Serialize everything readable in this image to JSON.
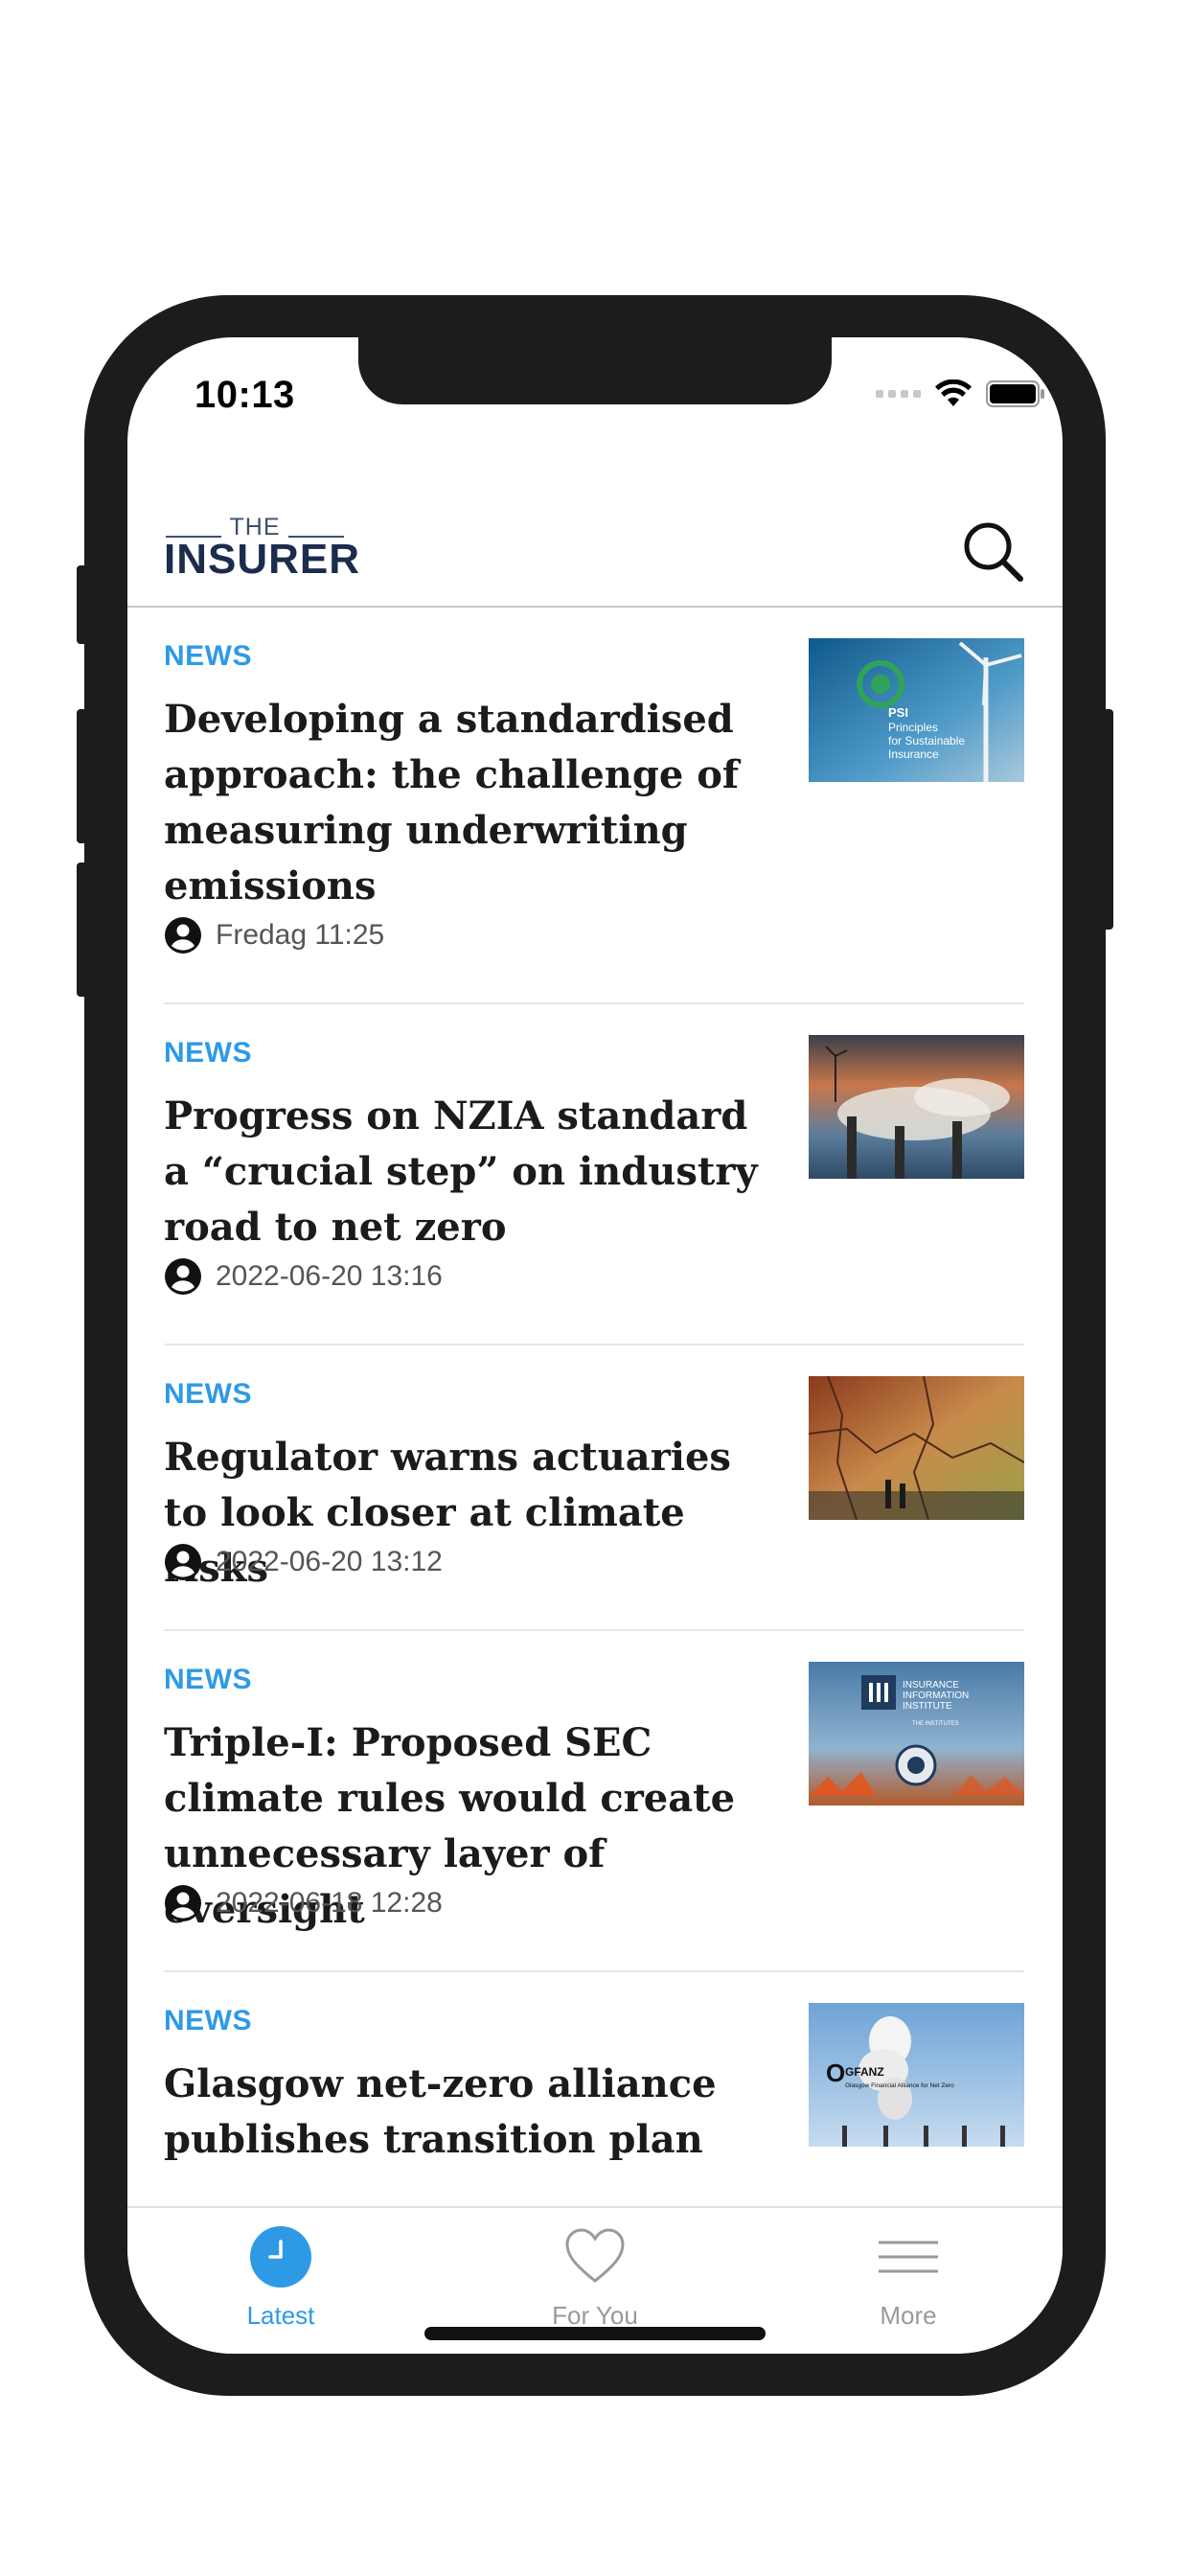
{
  "status_bar": {
    "time": "10:13"
  },
  "header": {
    "logo_top": "THE",
    "logo_main": "INSURER",
    "search_icon": "search-icon"
  },
  "articles": [
    {
      "category": "NEWS",
      "title": "Developing a standardised approach: the challenge of measuring underwriting emissions",
      "time": "Fredag 11:25",
      "image_text": "PSI Principles for Sustainable Insurance"
    },
    {
      "category": "NEWS",
      "title": "Progress on NZIA standard a “crucial step” on industry road to net zero",
      "time": "2022-06-20 13:16"
    },
    {
      "category": "NEWS",
      "title": "Regulator warns actuaries to look closer at climate risks",
      "time": "2022-06-20 13:12"
    },
    {
      "category": "NEWS",
      "title": "Triple-I: Proposed SEC climate rules would create unnecessary layer of oversight",
      "time": "2022-06-18 12:28",
      "image_text": "INSURANCE INFORMATION INSTITUTE",
      "image_subtext": "THE INSTITUTES"
    },
    {
      "category": "NEWS",
      "title": "Glasgow net-zero alliance publishes transition plan guidance",
      "image_text": "GFANZ",
      "image_subtext": "Glasgow Financial Alliance for Net Zero"
    }
  ],
  "tabs": [
    {
      "label": "Latest",
      "icon": "clock-icon",
      "active": true
    },
    {
      "label": "For You",
      "icon": "heart-icon",
      "active": false
    },
    {
      "label": "More",
      "icon": "menu-icon",
      "active": false
    }
  ],
  "colors": {
    "accent": "#2e9ae6",
    "frame": "#1c1c1e",
    "headline": "#1b1b1b"
  }
}
